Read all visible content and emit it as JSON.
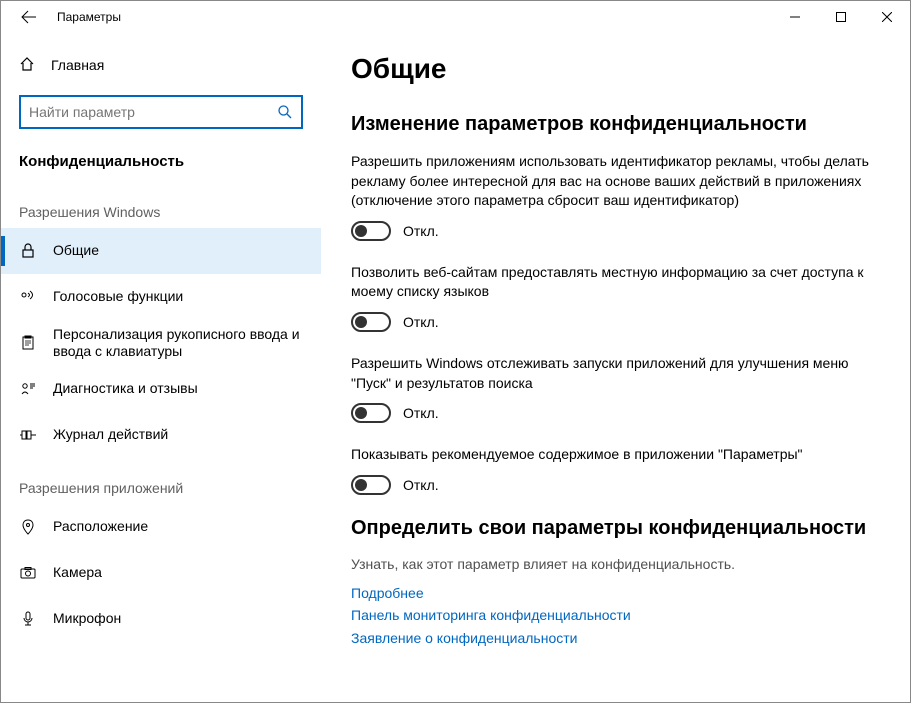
{
  "window": {
    "title": "Параметры"
  },
  "sidebar": {
    "home": "Главная",
    "search_placeholder": "Найти параметр",
    "category": "Конфиденциальность",
    "group1_title": "Разрешения Windows",
    "group1": [
      {
        "label": "Общие"
      },
      {
        "label": "Голосовые функции"
      },
      {
        "label": "Персонализация рукописного ввода и ввода с клавиатуры"
      },
      {
        "label": "Диагностика и отзывы"
      },
      {
        "label": "Журнал действий"
      }
    ],
    "group2_title": "Разрешения приложений",
    "group2": [
      {
        "label": "Расположение"
      },
      {
        "label": "Камера"
      },
      {
        "label": "Микрофон"
      }
    ]
  },
  "page": {
    "title": "Общие",
    "section1_title": "Изменение параметров конфиденциальности",
    "settings": [
      {
        "desc": "Разрешить приложениям использовать идентификатор рекламы, чтобы делать рекламу более интересной для вас на основе ваших действий в приложениях (отключение этого параметра сбросит ваш идентификатор)",
        "state": "Откл."
      },
      {
        "desc": "Позволить веб-сайтам предоставлять местную информацию за счет доступа к моему списку языков",
        "state": "Откл."
      },
      {
        "desc": "Разрешить Windows отслеживать запуски приложений для улучшения меню \"Пуск\" и результатов поиска",
        "state": "Откл."
      },
      {
        "desc": "Показывать рекомендуемое содержимое в приложении \"Параметры\"",
        "state": "Откл."
      }
    ],
    "section2_title": "Определить свои параметры конфиденциальности",
    "links_intro": "Узнать, как этот параметр влияет на конфиденциальность.",
    "links": [
      "Подробнее",
      "Панель мониторинга конфиденциальности",
      "Заявление о конфиденциальности"
    ]
  }
}
